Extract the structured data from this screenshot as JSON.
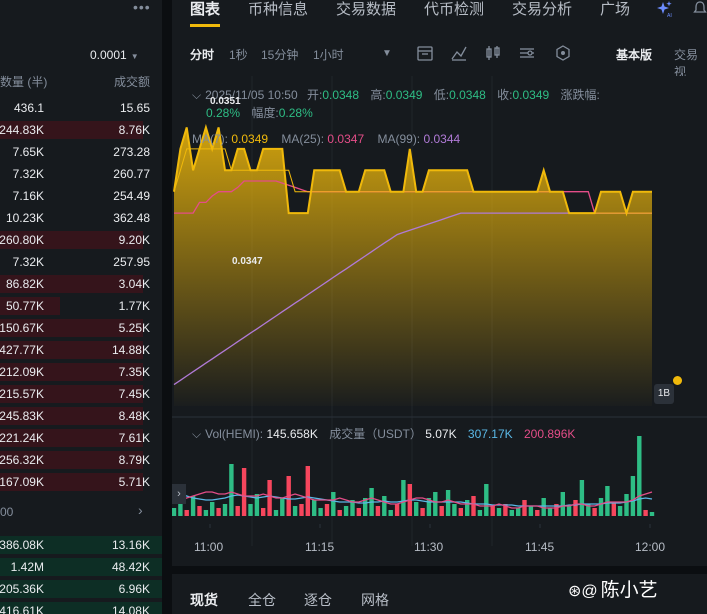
{
  "orderbook": {
    "more_icon": "more-dots-icon",
    "precision": "0.0001",
    "qty_header": "数量 (半)",
    "amount_header": "成交额",
    "asks": [
      {
        "qty": "436.1",
        "amount": "15.65",
        "depth": 0.0
      },
      {
        "qty": "244.83K",
        "amount": "8.76K",
        "depth": 0.95
      },
      {
        "qty": "7.65K",
        "amount": "273.28",
        "depth": 0.0
      },
      {
        "qty": "7.32K",
        "amount": "260.77",
        "depth": 0.0
      },
      {
        "qty": "7.16K",
        "amount": "254.49",
        "depth": 0.0
      },
      {
        "qty": "10.23K",
        "amount": "362.48",
        "depth": 0.0
      },
      {
        "qty": "260.80K",
        "amount": "9.20K",
        "depth": 0.95
      },
      {
        "qty": "7.32K",
        "amount": "257.95",
        "depth": 0.0
      },
      {
        "qty": "86.82K",
        "amount": "3.04K",
        "depth": 0.95
      },
      {
        "qty": "50.77K",
        "amount": "1.77K",
        "depth": 0.4
      },
      {
        "qty": "150.67K",
        "amount": "5.25K",
        "depth": 0.95
      },
      {
        "qty": "427.77K",
        "amount": "14.88K",
        "depth": 0.95
      },
      {
        "qty": "212.09K",
        "amount": "7.35K",
        "depth": 0.95
      },
      {
        "qty": "215.57K",
        "amount": "7.45K",
        "depth": 0.95
      },
      {
        "qty": "245.83K",
        "amount": "8.48K",
        "depth": 0.95
      },
      {
        "qty": "221.24K",
        "amount": "7.61K",
        "depth": 0.95
      },
      {
        "qty": "256.32K",
        "amount": "8.79K",
        "depth": 0.95
      },
      {
        "qty": "167.09K",
        "amount": "5.71K",
        "depth": 0.95
      }
    ],
    "mid_label": "00",
    "bids": [
      {
        "qty": "386.08K",
        "amount": "13.16K"
      },
      {
        "qty": "1.42M",
        "amount": "48.42K"
      },
      {
        "qty": "205.36K",
        "amount": "6.96K"
      },
      {
        "qty": "416.61K",
        "amount": "14.08K"
      }
    ]
  },
  "tabs": [
    "图表",
    "币种信息",
    "交易数据",
    "代币检测",
    "交易分析",
    "广场"
  ],
  "toolbar": {
    "items": [
      "分时",
      "1秒",
      "15分钟",
      "1小时"
    ],
    "basic": "基本版",
    "trade_view": "交易视"
  },
  "ohlc": {
    "datetime": "2025/11/05 10:50",
    "open_label": "开:",
    "open": "0.0348",
    "high_label": "高:",
    "high": "0.0349",
    "low_label": "低:",
    "low": "0.0348",
    "close_label": "收:",
    "close": "0.0349",
    "change_label": "涨跌幅:",
    "change": "0.28%",
    "amp_label": "幅度:",
    "amp": "0.28%"
  },
  "ma": {
    "ma7_label": "MA(7):",
    "ma7": "0.0349",
    "ma25_label": "MA(25):",
    "ma25": "0.0347",
    "ma99_label": "MA(99):",
    "ma99": "0.0344"
  },
  "price_tags": {
    "low": "0.0347",
    "high": "0.0351"
  },
  "volume": {
    "label": "Vol(HEMI):",
    "value": "145.658K",
    "usdt_label": "成交量（USDT）",
    "usdt": "5.07K",
    "ma_a": "307.17K",
    "ma_b": "200.896K"
  },
  "time_axis": [
    "11:00",
    "11:15",
    "11:30",
    "11:45",
    "12:00"
  ],
  "bottom_tabs": [
    "现货",
    "全仓",
    "逐仓",
    "网格"
  ],
  "watermark": "陈小艺",
  "colors": {
    "accent": "#f0b90b",
    "up": "#2ebd85",
    "down": "#f6465d",
    "ma25": "#e44d88",
    "ma99": "#b07ad6"
  },
  "chart_data": {
    "type": "line",
    "price_series": [
      0.0348,
      0.035,
      0.0351,
      0.0349,
      0.035,
      0.0351,
      0.035,
      0.0351,
      0.0349,
      0.0349,
      0.035,
      0.035,
      0.0349,
      0.0349,
      0.035,
      0.035,
      0.035,
      0.035,
      0.0347,
      0.0347,
      0.0347,
      0.0347,
      0.0349,
      0.0349,
      0.0349,
      0.0349,
      0.0349,
      0.0348,
      0.0348,
      0.0348,
      0.0349,
      0.0349,
      0.0349,
      0.0349,
      0.0348,
      0.0348,
      0.0348,
      0.035,
      0.0348,
      0.0348,
      0.0349,
      0.0349,
      0.0349,
      0.0349,
      0.0349,
      0.0349,
      0.0349,
      0.0348,
      0.0348,
      0.0348,
      0.0348,
      0.0348,
      0.0348,
      0.0348,
      0.0348,
      0.0348,
      0.0348,
      0.0348,
      0.0349,
      0.0348,
      0.0348,
      0.0348,
      0.0347,
      0.0347,
      0.0347,
      0.0347,
      0.0347,
      0.0348,
      0.0348,
      0.0348,
      0.0348,
      0.0347,
      0.0348,
      0.0348,
      0.0348,
      0.0348
    ],
    "ma7": [
      0.0348,
      0.0349,
      0.035,
      0.035,
      0.035,
      0.035,
      0.035,
      0.035,
      0.035,
      0.0349,
      0.0349,
      0.0349,
      0.0349,
      0.0349,
      0.0349,
      0.0349,
      0.0349,
      0.0349,
      0.0349,
      0.0348,
      0.0348,
      0.0348,
      0.0348,
      0.0348,
      0.0348,
      0.0348,
      0.0348,
      0.0348,
      0.0348,
      0.0348,
      0.0348,
      0.0348,
      0.0348,
      0.0348,
      0.0348,
      0.0348,
      0.0348,
      0.0348,
      0.0348,
      0.0348,
      0.0348,
      0.0348,
      0.0348,
      0.0348,
      0.0348,
      0.0348,
      0.0348,
      0.0348,
      0.0348,
      0.0348,
      0.0348,
      0.0348,
      0.0348,
      0.0348,
      0.0348,
      0.0348,
      0.0348,
      0.0348,
      0.0348,
      0.0348,
      0.0348,
      0.0348,
      0.0347,
      0.0347,
      0.0347,
      0.0347,
      0.0347,
      0.0347,
      0.0347,
      0.0347,
      0.0347,
      0.0347,
      0.0347,
      0.0347,
      0.0347,
      0.0347
    ],
    "ma25": [
      0.0347,
      0.0347,
      0.0347,
      0.0347,
      0.03475,
      0.03475,
      0.03478,
      0.0348,
      0.0348,
      0.0348,
      0.03482,
      0.03485,
      0.03485,
      0.03485,
      0.03485,
      0.03485,
      0.03485,
      0.03484,
      0.03483,
      0.03482,
      0.03481,
      0.0348,
      0.0348,
      0.0348,
      0.0348,
      0.0348,
      0.0348,
      0.0348,
      0.0348,
      0.0348,
      0.0348,
      0.0348,
      0.0348,
      0.0348,
      0.0348,
      0.0348,
      0.0348,
      0.0348,
      0.0348,
      0.0348,
      0.0348,
      0.0348,
      0.0348,
      0.0348,
      0.0348,
      0.0348,
      0.0348,
      0.0348,
      0.0348,
      0.0348,
      0.0348,
      0.0348,
      0.0348,
      0.0348,
      0.0348,
      0.0348,
      0.0348,
      0.0348,
      0.0348,
      0.0348,
      0.0348,
      0.0348,
      0.0348,
      0.0348,
      0.0348,
      0.0348,
      0.0347,
      0.0347,
      0.0347,
      0.0347,
      0.0347,
      0.0347,
      0.0347,
      0.0347,
      0.0347,
      0.0347
    ],
    "ma99": [
      0.0339,
      0.03392,
      0.03394,
      0.03396,
      0.03398,
      0.034,
      0.03402,
      0.03404,
      0.03406,
      0.03408,
      0.0341,
      0.03412,
      0.03414,
      0.03416,
      0.03418,
      0.0342,
      0.03422,
      0.03424,
      0.03426,
      0.03428,
      0.0343,
      0.03432,
      0.03434,
      0.03436,
      0.03438,
      0.0344,
      0.03442,
      0.03444,
      0.03446,
      0.03448,
      0.0345,
      0.03452,
      0.03454,
      0.03456,
      0.03458,
      0.0346,
      0.03461,
      0.03462,
      0.03463,
      0.03464,
      0.03465,
      0.03466,
      0.03467,
      0.03468,
      0.03469,
      0.0347,
      0.0347,
      0.0347,
      0.0347,
      0.0347,
      0.0347,
      0.0347,
      0.0347,
      0.0347,
      0.0347,
      0.0347,
      0.0347,
      0.0347,
      0.0347,
      0.0347,
      0.0347,
      0.0347,
      0.0347,
      0.0347,
      0.0347,
      0.0347,
      0.0347,
      0.0347,
      0.0347,
      0.0347,
      0.0347,
      0.0347,
      0.0347,
      0.0347,
      0.0347,
      0.0347
    ],
    "ylim": [
      0.0338,
      0.0352
    ],
    "volumes": [
      0.4,
      0.8,
      0.3,
      1.0,
      0.5,
      0.3,
      0.7,
      0.4,
      0.6,
      2.6,
      0.5,
      2.4,
      0.6,
      1.1,
      0.4,
      1.8,
      0.3,
      0.9,
      2.0,
      0.5,
      0.6,
      2.5,
      0.8,
      0.4,
      0.6,
      1.2,
      0.3,
      0.5,
      0.8,
      0.4,
      0.9,
      1.4,
      0.5,
      1.0,
      0.3,
      0.6,
      1.8,
      1.6,
      0.7,
      0.4,
      0.9,
      1.2,
      0.5,
      1.3,
      0.6,
      0.4,
      0.8,
      1.0,
      0.3,
      1.6,
      0.5,
      0.4,
      0.6,
      0.3,
      0.4,
      0.8,
      0.5,
      0.3,
      0.9,
      0.4,
      0.6,
      1.2,
      0.5,
      0.8,
      1.8,
      0.6,
      0.4,
      0.9,
      1.5,
      0.7,
      0.5,
      1.1,
      2.0,
      4.0,
      0.3,
      0.2
    ],
    "vol_up": [
      1,
      1,
      0,
      1,
      0,
      1,
      1,
      0,
      1,
      1,
      0,
      0,
      1,
      1,
      0,
      0,
      1,
      1,
      0,
      1,
      0,
      0,
      1,
      1,
      0,
      1,
      0,
      1,
      1,
      0,
      1,
      1,
      0,
      1,
      1,
      0,
      1,
      0,
      1,
      0,
      1,
      1,
      0,
      1,
      1,
      0,
      1,
      0,
      1,
      1,
      0,
      1,
      0,
      1,
      1,
      0,
      1,
      0,
      1,
      1,
      0,
      1,
      1,
      0,
      1,
      1,
      0,
      1,
      1,
      0,
      1,
      1,
      1,
      1,
      0,
      1
    ],
    "vol_ma_a": [
      1.2,
      1.1,
      1.0,
      0.9,
      0.85,
      0.8,
      0.8,
      0.85,
      0.9,
      1.0,
      1.05,
      1.0,
      0.95,
      0.9,
      0.95,
      1.0,
      0.95,
      0.9,
      0.85,
      0.85,
      0.9,
      0.95,
      0.9,
      0.85,
      0.8,
      0.75,
      0.7,
      0.7,
      0.7,
      0.65,
      0.65,
      0.7,
      0.7,
      0.75,
      0.7,
      0.7,
      0.75,
      0.8,
      0.8,
      0.75,
      0.7,
      0.7,
      0.7,
      0.7,
      0.7,
      0.7,
      0.65,
      0.6,
      0.6,
      0.6,
      0.55,
      0.55,
      0.55,
      0.55,
      0.5,
      0.5,
      0.5,
      0.5,
      0.5,
      0.5,
      0.5,
      0.5,
      0.55,
      0.55,
      0.6,
      0.6,
      0.6,
      0.6,
      0.65,
      0.65,
      0.65,
      0.7,
      0.75,
      0.85,
      0.9,
      0.85
    ],
    "vol_ma_b": [
      0.8,
      0.8,
      0.9,
      1.0,
      1.1,
      1.2,
      1.2,
      1.1,
      1.1,
      1.2,
      1.1,
      1.0,
      1.0,
      1.0,
      1.1,
      1.0,
      0.9,
      0.9,
      1.0,
      1.1,
      1.0,
      0.9,
      0.8,
      0.8,
      0.8,
      0.8,
      0.9,
      0.8,
      0.7,
      0.7,
      0.8,
      0.9,
      0.8,
      0.7,
      0.6,
      0.6,
      0.7,
      0.8,
      0.9,
      0.9,
      0.8,
      0.7,
      0.7,
      0.8,
      0.7,
      0.6,
      0.6,
      0.6,
      0.5,
      0.5,
      0.5,
      0.6,
      0.5,
      0.4,
      0.4,
      0.5,
      0.5,
      0.5,
      0.4,
      0.4,
      0.4,
      0.5,
      0.5,
      0.6,
      0.6,
      0.5,
      0.5,
      0.6,
      0.7,
      0.7,
      0.7,
      0.7,
      0.8,
      1.0,
      1.1,
      1.2
    ]
  }
}
